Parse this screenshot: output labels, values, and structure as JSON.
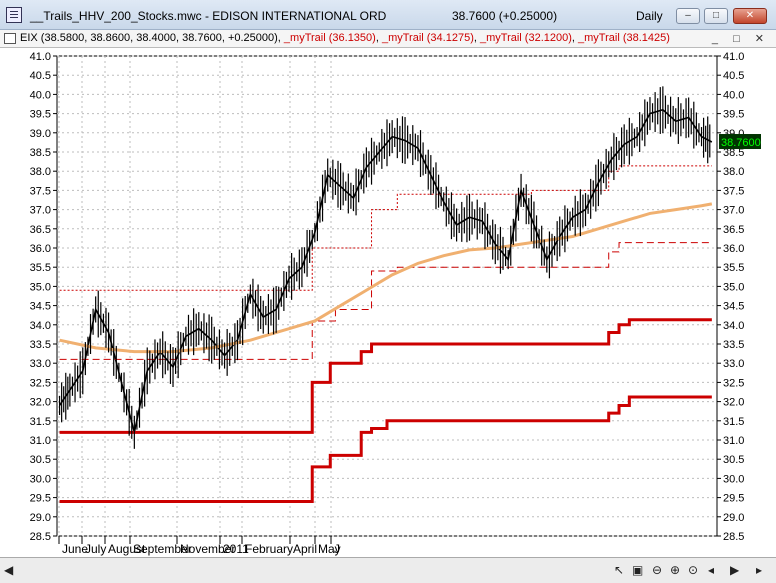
{
  "window": {
    "title": "__Trails_HHV_200_Stocks.mwc - EDISON INTERNATIONAL ORD",
    "price_summary": "38.7600 (+0.25000)",
    "period": "Daily",
    "buttons": {
      "minimize": "–",
      "maximize": "□",
      "close": "✕"
    }
  },
  "legend": {
    "symbol_text": "EIX (38.5800, 38.8600, 38.4000, 38.7600, +0.25000), ",
    "trails": [
      "_myTrail (36.1350)",
      "_myTrail (34.1275)",
      "_myTrail (32.1200)",
      "_myTrail (38.1425)"
    ],
    "separator": ", ",
    "buttons": "_ □ ✕"
  },
  "last_price_label": "38.7600",
  "colors": {
    "price": "#000000",
    "trail": "#cc0000",
    "ma": "#f0b070",
    "last_bg": "#003300",
    "last_fg": "#00ff00"
  },
  "statusbar_icons": [
    "scroll-left-icon",
    "scroll-right-icon",
    "cursor-icon",
    "chart-icon",
    "zoom-out-icon",
    "zoom-in-icon",
    "zoom-reset-icon",
    "pan-left-icon",
    "pan-right-icon"
  ],
  "chart_data": {
    "type": "line",
    "ylim": [
      28.5,
      41.0
    ],
    "y_ticks": [
      "28.5",
      "29.0",
      "29.5",
      "30.0",
      "30.5",
      "31.0",
      "31.5",
      "32.0",
      "32.5",
      "33.0",
      "33.5",
      "34.0",
      "34.5",
      "35.0",
      "35.5",
      "36.0",
      "36.5",
      "37.0",
      "37.5",
      "38.0",
      "38.5",
      "39.0",
      "39.5",
      "40.0",
      "40.5",
      "41.0"
    ],
    "x_ticks": [
      "June",
      "July",
      "August",
      "September",
      "November",
      "2011",
      "February",
      "April",
      "May",
      "J"
    ],
    "grid": true,
    "series": [
      {
        "style": "price-bars",
        "x": [
          1,
          5,
          10,
          15,
          20,
          25,
          30,
          35,
          40,
          45,
          50,
          55,
          60,
          65,
          70,
          75,
          80,
          85,
          90,
          95,
          100,
          105,
          110,
          115,
          120,
          125,
          130,
          135,
          140,
          145,
          150,
          155,
          160,
          165,
          170,
          175,
          180,
          185,
          190,
          195,
          200,
          205,
          210,
          215,
          220,
          225,
          230,
          235,
          240,
          245,
          250,
          254
        ],
        "values": [
          31.9,
          32.3,
          32.8,
          34.4,
          33.8,
          32.5,
          31.2,
          32.8,
          33.3,
          32.9,
          33.7,
          33.9,
          33.6,
          33.2,
          33.6,
          34.8,
          34.2,
          34.4,
          35.2,
          35.5,
          36.4,
          37.9,
          37.6,
          37.3,
          38.1,
          38.5,
          38.9,
          38.8,
          38.6,
          37.9,
          37.2,
          36.6,
          36.8,
          36.7,
          36.1,
          35.7,
          37.5,
          36.6,
          35.7,
          36.3,
          36.8,
          37.0,
          37.7,
          38.3,
          38.7,
          38.9,
          39.5,
          39.6,
          39.3,
          39.4,
          38.9,
          38.76
        ]
      },
      {
        "name": "_myTrail (38.1425)",
        "style": "thin-dotted",
        "x": [
          1,
          99,
          99,
          122,
          122,
          132,
          132,
          184,
          184,
          214,
          214,
          218,
          218,
          254
        ],
        "values": [
          34.9,
          34.9,
          36.0,
          36.0,
          37.0,
          37.0,
          37.4,
          37.4,
          37.5,
          37.5,
          38.0,
          38.0,
          38.14,
          38.14
        ]
      },
      {
        "name": "_myTrail (36.1350)",
        "style": "thin-dashed",
        "x": [
          1,
          99,
          99,
          108,
          108,
          122,
          122,
          132,
          132,
          184,
          184,
          214,
          214,
          218,
          218,
          254
        ],
        "values": [
          33.1,
          33.1,
          34.1,
          34.1,
          34.4,
          34.4,
          35.4,
          35.4,
          35.5,
          35.5,
          35.5,
          35.5,
          35.9,
          35.9,
          36.14,
          36.14
        ]
      },
      {
        "name": "_myTrail (34.1275)",
        "style": "thick",
        "x": [
          1,
          99,
          99,
          106,
          106,
          118,
          118,
          122,
          122,
          128,
          128,
          184,
          184,
          214,
          214,
          218,
          218,
          222,
          222,
          254
        ],
        "values": [
          31.2,
          31.2,
          32.5,
          32.5,
          33.0,
          33.0,
          33.3,
          33.3,
          33.5,
          33.5,
          33.5,
          33.5,
          33.5,
          33.5,
          33.8,
          33.8,
          34.0,
          34.0,
          34.13,
          34.13
        ]
      },
      {
        "name": "_myTrail (32.1200)",
        "style": "thick",
        "x": [
          1,
          99,
          99,
          106,
          106,
          118,
          118,
          122,
          122,
          128,
          128,
          184,
          184,
          214,
          214,
          218,
          218,
          222,
          222,
          254
        ],
        "values": [
          29.4,
          29.4,
          30.3,
          30.3,
          30.6,
          30.6,
          31.2,
          31.2,
          31.3,
          31.3,
          31.5,
          31.5,
          31.5,
          31.5,
          31.7,
          31.7,
          31.9,
          31.9,
          32.12,
          32.12
        ]
      },
      {
        "style": "moving-average",
        "x": [
          1,
          15,
          30,
          45,
          60,
          75,
          90,
          100,
          110,
          120,
          130,
          140,
          150,
          160,
          170,
          180,
          190,
          200,
          210,
          220,
          230,
          240,
          250,
          254
        ],
        "values": [
          33.6,
          33.4,
          33.3,
          33.3,
          33.4,
          33.6,
          33.9,
          34.1,
          34.5,
          34.9,
          35.3,
          35.6,
          35.8,
          35.95,
          36.0,
          36.1,
          36.2,
          36.3,
          36.5,
          36.7,
          36.9,
          37.0,
          37.1,
          37.15
        ]
      }
    ]
  }
}
